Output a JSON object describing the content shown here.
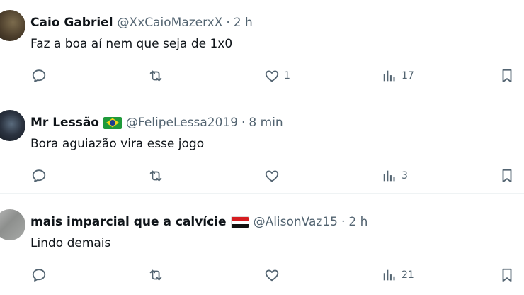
{
  "posts": [
    {
      "name": "Caio Gabriel",
      "flag": "",
      "handle": "@XxCaioMazerxX",
      "separator": "·",
      "time": "2 h",
      "text": "Faz a boa aí nem que seja de 1x0",
      "likes": "1",
      "views": "17"
    },
    {
      "name": "Mr Lessão",
      "flag": "brazil-flag",
      "handle": "@FelipeLessa2019",
      "separator": "·",
      "time": "8 min",
      "text": "Bora aguiazão vira esse jogo",
      "likes": "",
      "views": "3"
    },
    {
      "name": "mais imparcial que a calvície",
      "flag": "sao-paulo-flag",
      "handle": "@AlisonVaz15",
      "separator": "·",
      "time": "2 h",
      "text": "Lindo demais",
      "likes": "",
      "views": "21"
    }
  ],
  "colors": {
    "text": "#0f1419",
    "secondary": "#536471",
    "divider": "#eff3f4"
  }
}
